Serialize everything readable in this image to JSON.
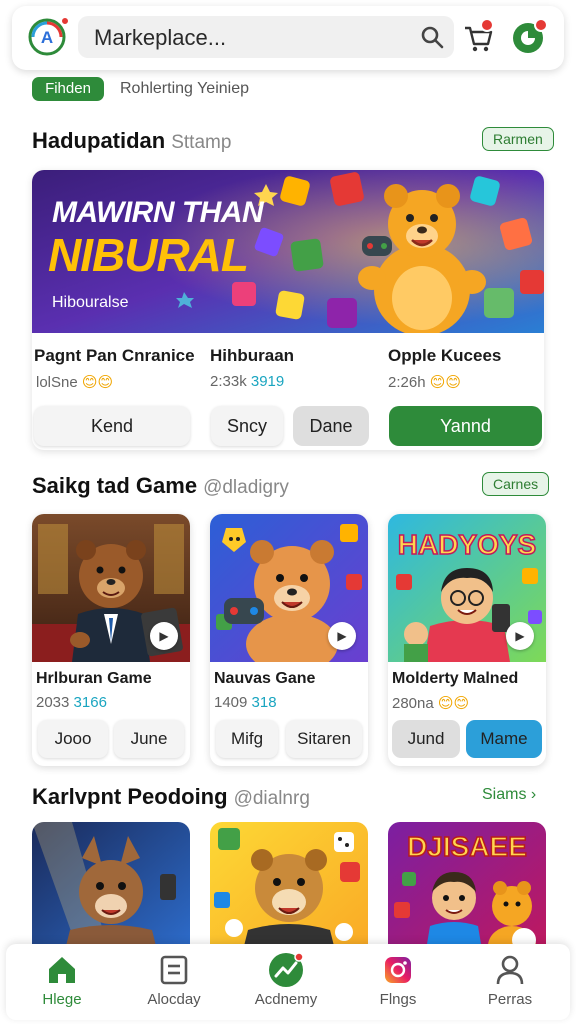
{
  "header": {
    "search_placeholder": "Markeplace...",
    "cart_icon": "cart-icon",
    "profile_icon": "profile-icon",
    "logo_icon": "app-logo-icon"
  },
  "filters": {
    "active": "Fihden",
    "other": "Rohlerting Yeiniep"
  },
  "section1": {
    "title": "Hadupatidan",
    "subtitle": "Sttamp",
    "pill": "Rarmen",
    "banner": {
      "line1": "MAWIRN THAN",
      "line2": "NIBURAL",
      "sub": "Hibouralse"
    },
    "items": [
      {
        "title": "Pagnt Pan Cnranice",
        "meta1": "lolSne",
        "meta2": "",
        "emoji": "😊😊"
      },
      {
        "title": "Hihburaan",
        "meta1": "2:33k",
        "meta2": "3919",
        "emoji": ""
      },
      {
        "title": "Opple Kucees",
        "meta1": "2:26h",
        "meta2": "",
        "emoji": "😊😊"
      }
    ],
    "buttons": [
      "Kend",
      "Sncy",
      "Dane",
      "Yannd"
    ]
  },
  "section2": {
    "title": "Saikg tad Game",
    "subtitle": "@dladigry",
    "pill": "Carnes",
    "cards": [
      {
        "title": "Hrlburan Game",
        "meta1": "2033",
        "meta2": "3166",
        "emoji": "",
        "btn1": "Jooo",
        "btn2": "June",
        "art_text": ""
      },
      {
        "title": "Nauvas Gane",
        "meta1": "1409",
        "meta2": "318",
        "emoji": "",
        "btn1": "Mifg",
        "btn2": "Sitaren",
        "art_text": ""
      },
      {
        "title": "Molderty Malned",
        "meta1": "280na",
        "meta2": "",
        "emoji": "😊😊",
        "btn1": "Jund",
        "btn2": "Mame",
        "art_text": "HADYOYS"
      }
    ]
  },
  "section3": {
    "title": "Karlvpnt Peodoing",
    "subtitle": "@dialnrg",
    "see_all": "Siams ›",
    "cards": [
      {
        "art_text": ""
      },
      {
        "art_text": ""
      },
      {
        "art_text": "DJISAEE"
      }
    ]
  },
  "nav": [
    {
      "label": "Hlege",
      "icon": "home-icon",
      "active": true
    },
    {
      "label": "Alocday",
      "icon": "list-icon",
      "active": false
    },
    {
      "label": "Acdnemy",
      "icon": "trending-icon",
      "active": false
    },
    {
      "label": "Flngs",
      "icon": "camera-icon",
      "active": false
    },
    {
      "label": "Perras",
      "icon": "person-icon",
      "active": false
    }
  ],
  "colors": {
    "accent_green": "#2e8b3a",
    "accent_blue": "#2c9fd9",
    "badge_red": "#e53935"
  }
}
